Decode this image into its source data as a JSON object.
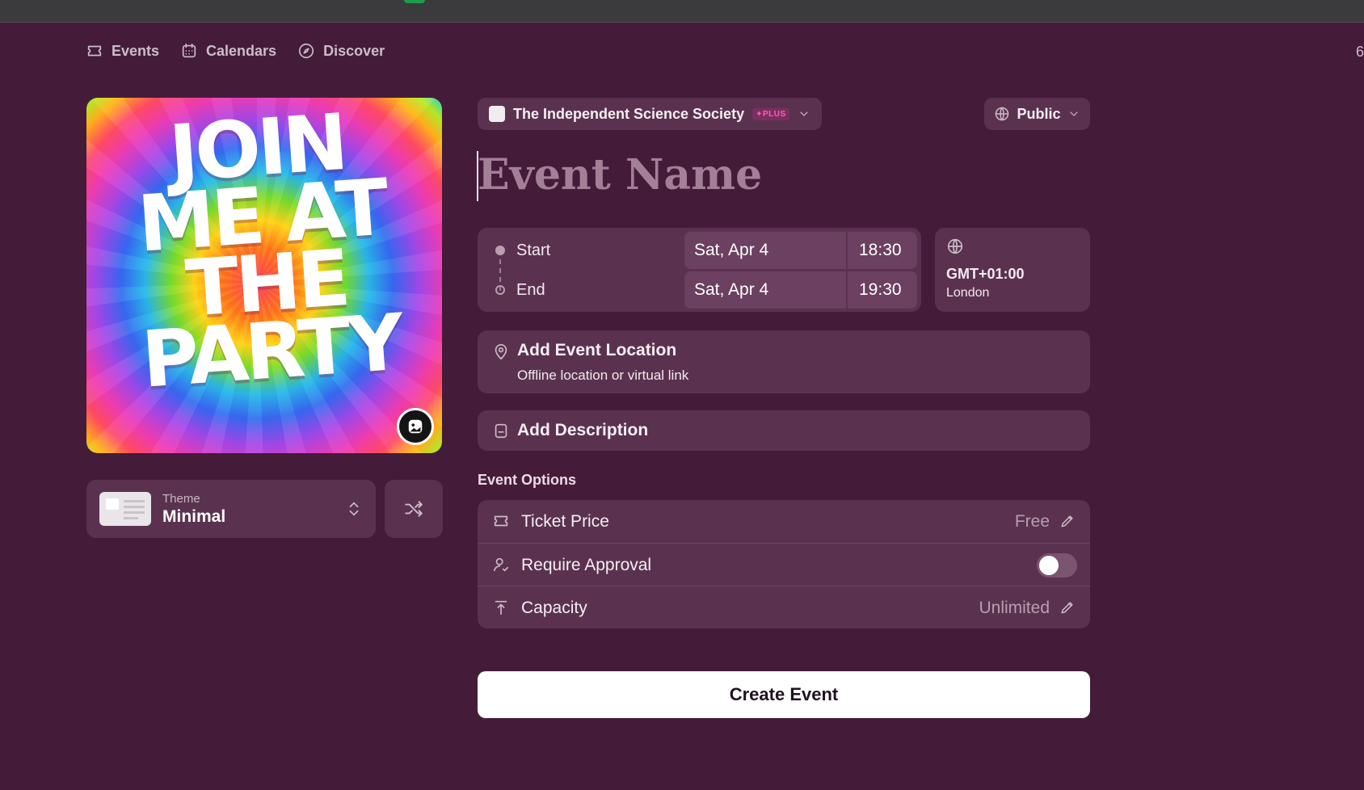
{
  "nav": {
    "events": "Events",
    "calendars": "Calendars",
    "discover": "Discover",
    "edge_text": "6"
  },
  "cover": {
    "line1": "JOIN",
    "line2": "ME AT",
    "line3": "THE",
    "line4": "PARTY"
  },
  "theme": {
    "label": "Theme",
    "value": "Minimal"
  },
  "calendar": {
    "name": "The Independent Science Society",
    "badge": "✦PLUS"
  },
  "visibility": {
    "label": "Public"
  },
  "event_name": {
    "placeholder": "Event Name"
  },
  "datetime": {
    "start_label": "Start",
    "start_date": "Sat, Apr 4",
    "start_time": "18:30",
    "end_label": "End",
    "end_date": "Sat, Apr 4",
    "end_time": "19:30"
  },
  "timezone": {
    "offset": "GMT+01:00",
    "city": "London"
  },
  "location": {
    "title": "Add Event Location",
    "subtitle": "Offline location or virtual link"
  },
  "description": {
    "title": "Add Description"
  },
  "options": {
    "heading": "Event Options",
    "ticket_label": "Ticket Price",
    "ticket_value": "Free",
    "approval_label": "Require Approval",
    "capacity_label": "Capacity",
    "capacity_value": "Unlimited"
  },
  "create_button": "Create Event"
}
